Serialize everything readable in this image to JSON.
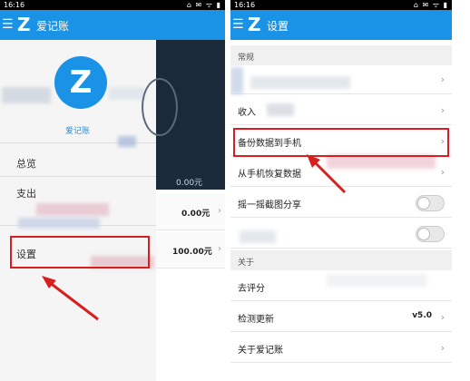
{
  "left_phone": {
    "status": {
      "time": "16:16",
      "icons": "⌂ ✉ ᯤ ▮"
    },
    "appbar": {
      "title": "爱记账",
      "logo": "Z",
      "menu": "☰"
    },
    "drawer": {
      "avatar_letter": "Z",
      "avatar_name": "爱记账",
      "items": [
        "总览",
        "支出",
        "设置"
      ]
    },
    "content": {
      "zero_dim": "0.00元",
      "row1_amount": "0.00元",
      "row2_amount": "100.00元",
      "chevron": "›"
    }
  },
  "right_phone": {
    "status": {
      "time": "16:16",
      "icons": "⌂ ✉ ᯤ ▮"
    },
    "appbar": {
      "title": "设置",
      "logo": "Z",
      "menu": "☰"
    },
    "sections": {
      "general": "常规",
      "about": "关于"
    },
    "rows": {
      "income_expense": "收入",
      "backup": "备份数据到手机",
      "restore": "从手机恢复数据",
      "shake": "摇一摇截图分享",
      "rate": "去评分",
      "check_update": "检测更新",
      "version": "v5.0",
      "about_app": "关于爱记账"
    },
    "chevron": "›"
  },
  "colors": {
    "brand": "#1a92e6",
    "highlight": "#d81e1e"
  }
}
